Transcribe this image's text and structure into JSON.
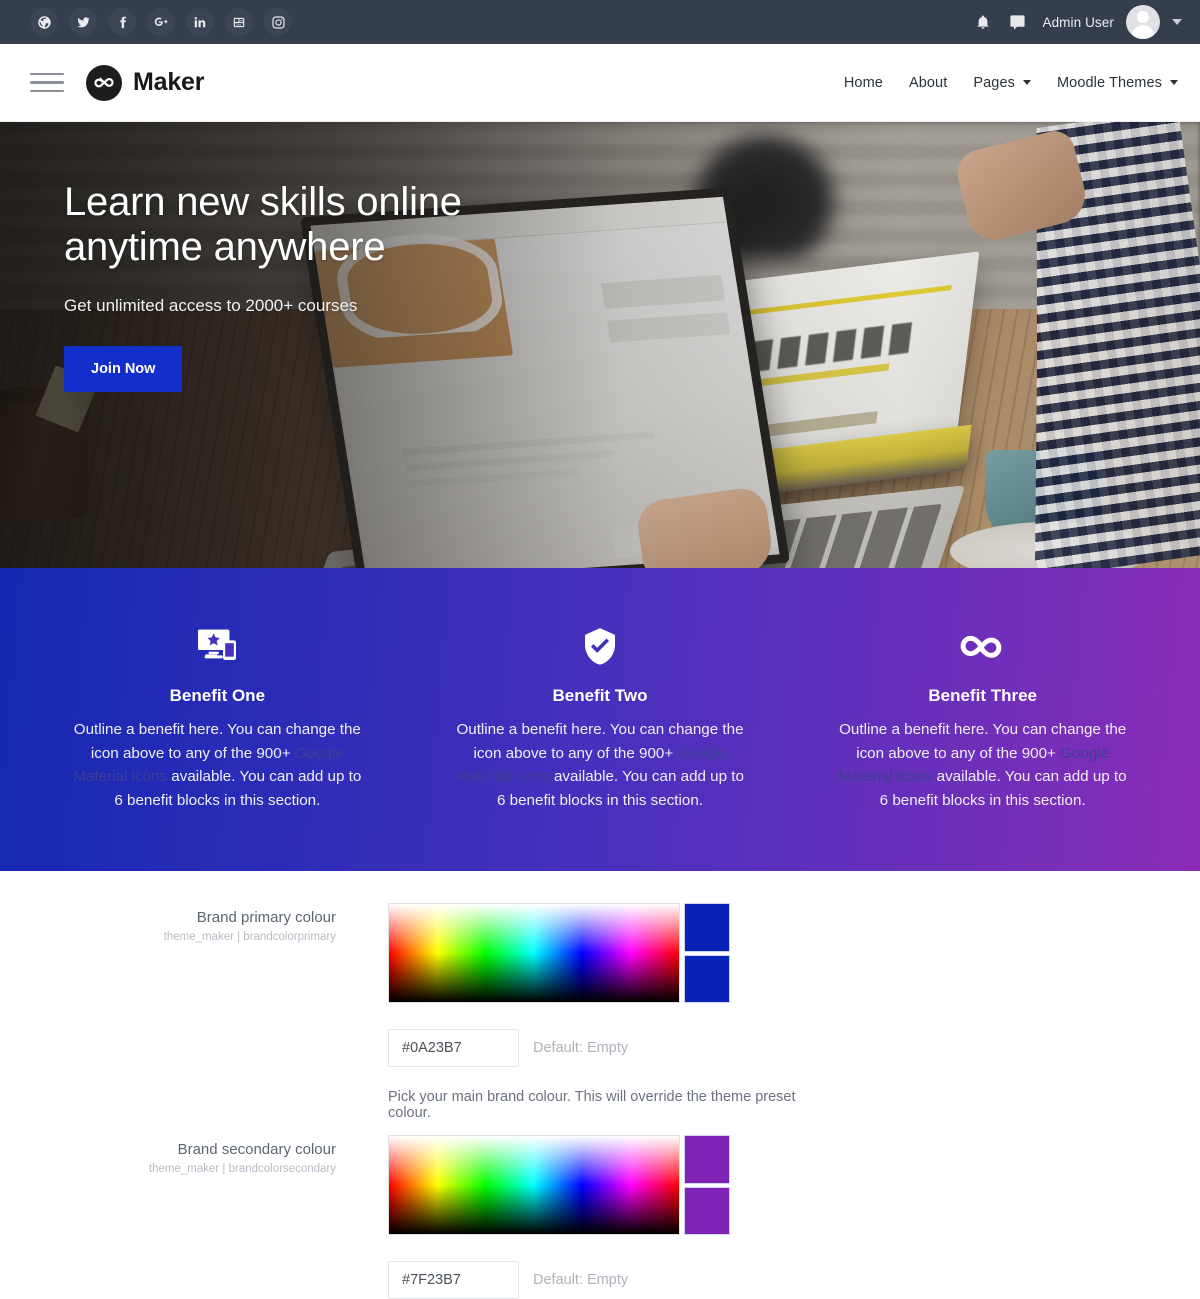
{
  "topbar": {
    "social": [
      {
        "name": "globe-icon",
        "label": "Website"
      },
      {
        "name": "twitter-icon",
        "label": "Twitter"
      },
      {
        "name": "facebook-icon",
        "label": "Facebook"
      },
      {
        "name": "google-plus-icon",
        "label": "Google Plus"
      },
      {
        "name": "linkedin-icon",
        "label": "LinkedIn"
      },
      {
        "name": "youtube-icon",
        "label": "YouTube"
      },
      {
        "name": "instagram-icon",
        "label": "Instagram"
      }
    ],
    "notifications_icon": "bell-icon",
    "messages_icon": "chat-bubble-icon",
    "user_name": "Admin User",
    "avatar_alt": "Admin User avatar",
    "caret": "chevron-down-icon"
  },
  "navbar": {
    "menu_icon": "hamburger-menu-icon",
    "logo_icon": "infinity-icon",
    "brand": "Maker",
    "links": [
      {
        "label": "Home",
        "has_caret": false
      },
      {
        "label": "About",
        "has_caret": false
      },
      {
        "label": "Pages",
        "has_caret": true
      },
      {
        "label": "Moodle Themes",
        "has_caret": true
      }
    ]
  },
  "hero": {
    "title": "Learn new skills online\nanytime anywhere",
    "subtitle": "Get unlimited access to 2000+ courses",
    "cta_label": "Join Now",
    "cta_color": "#122ecb"
  },
  "benefits": {
    "gradient_from": "#1527B3",
    "gradient_to": "#8A2CB8",
    "items": [
      {
        "icon": "important-devices-icon",
        "title": "Benefit One",
        "text_before": "Outline a benefit here. You can change the icon above to any of the 900+ ",
        "link_text": "Google Material icons",
        "text_after": " available. You can add up to 6 benefit blocks in this section."
      },
      {
        "icon": "verified-user-shield-icon",
        "title": "Benefit Two",
        "text_before": "Outline a benefit here. You can change the icon above to any of the 900+ ",
        "link_text": "Google Material icons",
        "text_after": " available. You can add up to 6 benefit blocks in this section."
      },
      {
        "icon": "all-inclusive-infinity-icon",
        "title": "Benefit Three",
        "text_before": "Outline a benefit here. You can change the icon above to any of the 900+ ",
        "link_text": "Google Material icons",
        "text_after": " available. You can add up to 6 benefit blocks in this section."
      }
    ]
  },
  "settings": {
    "rows": [
      {
        "label": "Brand primary colour",
        "sublabel": "theme_maker | brandcolorprimary",
        "value": "#0A23B7",
        "placeholder": "#0A23B7",
        "default_text": "Default: Empty",
        "swatch_color": "#0A23B7",
        "help": "Pick your main brand colour. This will override the theme preset colour."
      },
      {
        "label": "Brand secondary colour",
        "sublabel": "theme_maker | brandcolorsecondary",
        "value": "#7F23B7",
        "placeholder": "#7F23B7",
        "default_text": "Default: Empty",
        "swatch_color": "#7F23B7",
        "help": ""
      }
    ]
  }
}
